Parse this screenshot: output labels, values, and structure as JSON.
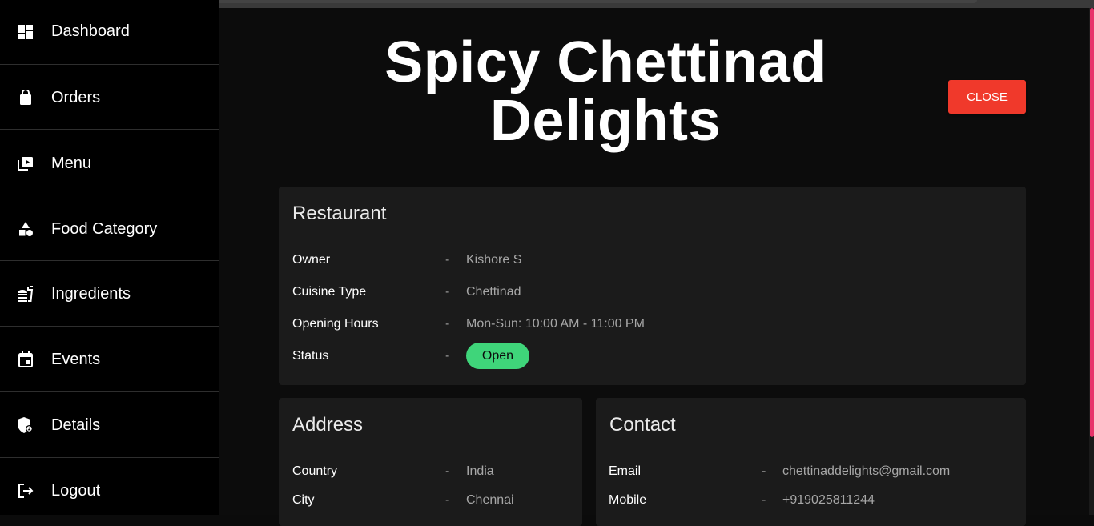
{
  "sidebar": {
    "items": [
      {
        "label": "Dashboard",
        "icon": "dashboard-icon"
      },
      {
        "label": "Orders",
        "icon": "shopping-bag-icon"
      },
      {
        "label": "Menu",
        "icon": "video-library-icon"
      },
      {
        "label": "Food Category",
        "icon": "category-icon"
      },
      {
        "label": "Ingredients",
        "icon": "fastfood-icon"
      },
      {
        "label": "Events",
        "icon": "calendar-icon"
      },
      {
        "label": "Details",
        "icon": "admin-shield-icon"
      },
      {
        "label": "Logout",
        "icon": "logout-icon"
      }
    ]
  },
  "header": {
    "title": "Spicy Chettinad Delights",
    "close_label": "CLOSE"
  },
  "restaurant": {
    "title": "Restaurant",
    "rows": [
      {
        "label": "Owner",
        "value": "Kishore S"
      },
      {
        "label": "Cuisine Type",
        "value": "Chettinad"
      },
      {
        "label": "Opening Hours",
        "value": "Mon-Sun: 10:00 AM - 11:00 PM"
      },
      {
        "label": "Status",
        "value": "Open"
      }
    ]
  },
  "address": {
    "title": "Address",
    "rows": [
      {
        "label": "Country",
        "value": "India"
      },
      {
        "label": "City",
        "value": "Chennai"
      }
    ]
  },
  "contact": {
    "title": "Contact",
    "rows": [
      {
        "label": "Email",
        "value": "chettinaddelights@gmail.com"
      },
      {
        "label": "Mobile",
        "value": "+919025811244"
      }
    ]
  },
  "separator": "-",
  "colors": {
    "close_button": "#f0392b",
    "status_open": "#3fd57a",
    "scrollbar": "#e8336a"
  }
}
